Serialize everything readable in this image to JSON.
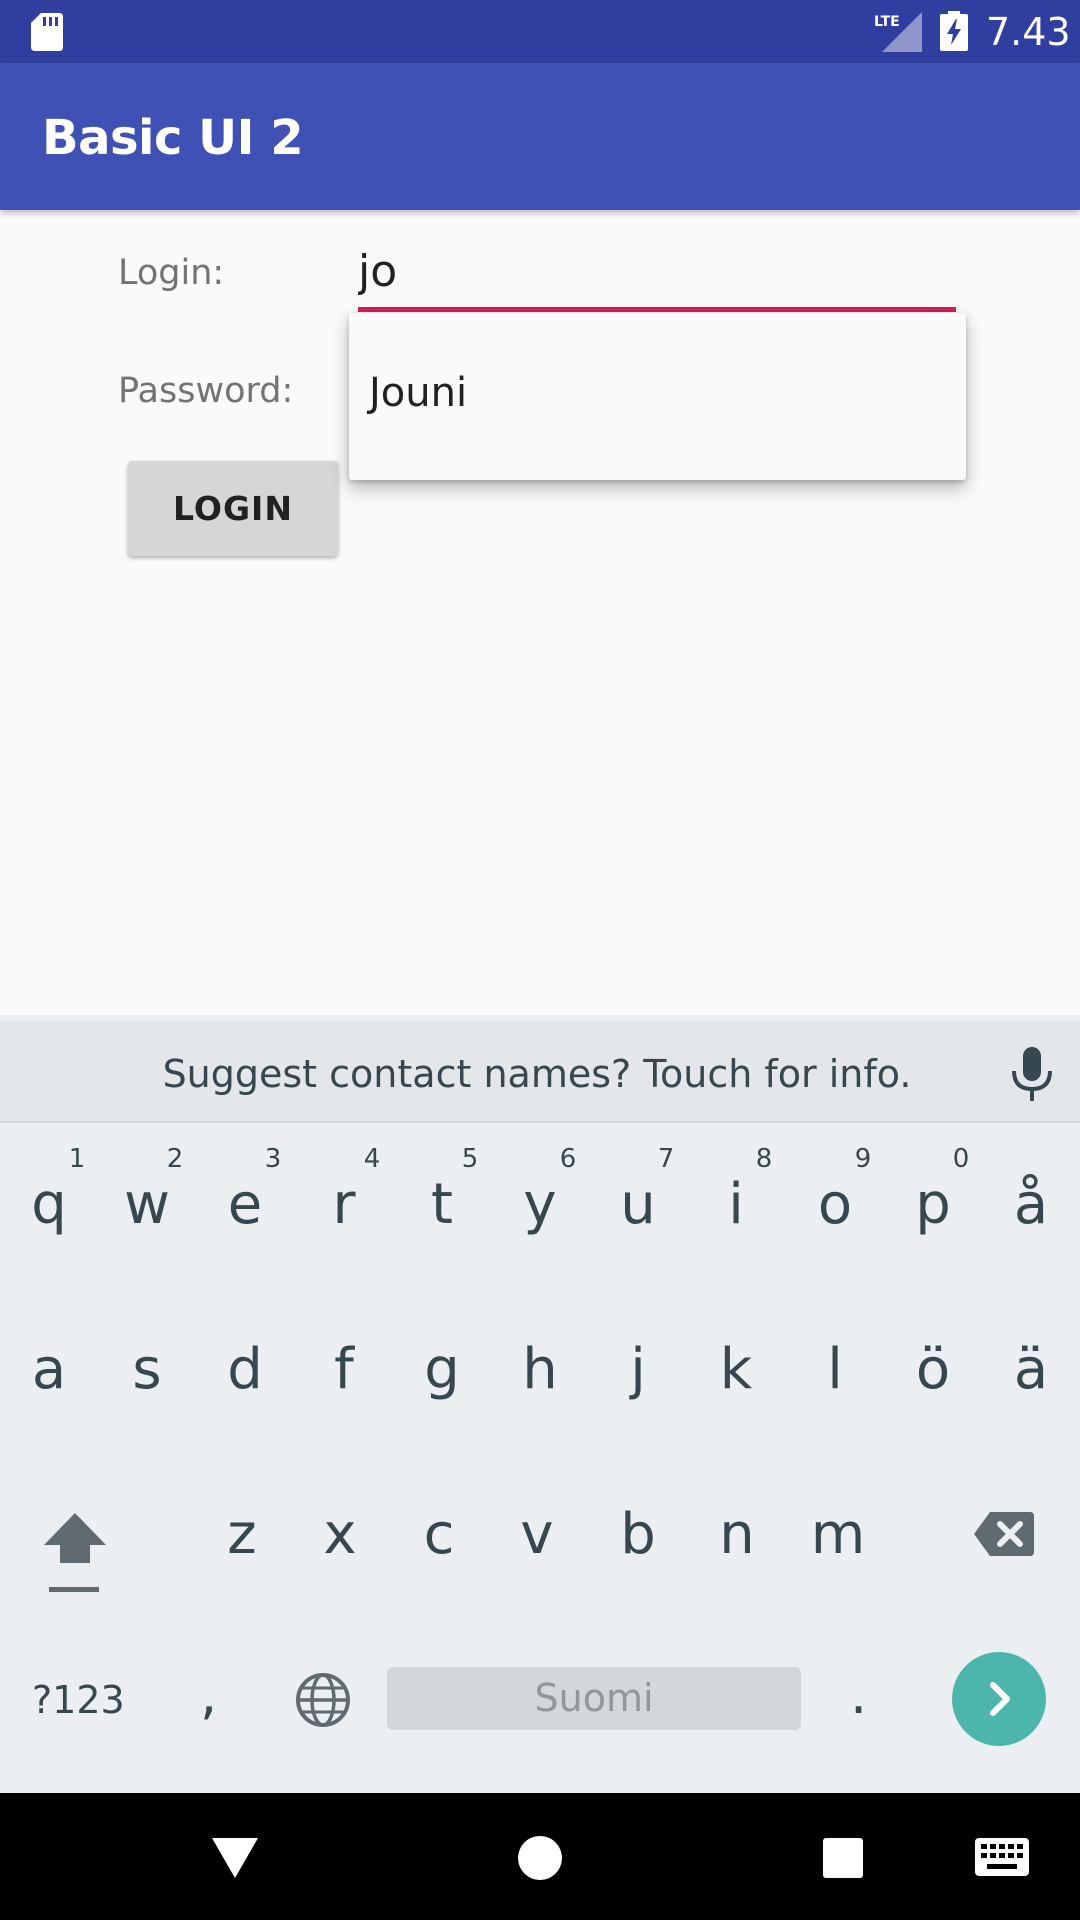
{
  "status_bar": {
    "time": "7.43",
    "network": "LTE",
    "icons": [
      "sd-card-icon",
      "lte-signal-icon",
      "battery-charging-icon"
    ]
  },
  "app_bar": {
    "title": "Basic UI 2"
  },
  "form": {
    "login_label": "Login:",
    "login_value": "jo",
    "password_label": "Password:",
    "login_button": "LOGIN"
  },
  "autocomplete": {
    "items": [
      "Jouni"
    ]
  },
  "keyboard": {
    "suggestion": "Suggest contact names? Touch for info.",
    "row1": [
      "q",
      "w",
      "e",
      "r",
      "t",
      "y",
      "u",
      "i",
      "o",
      "p",
      "å"
    ],
    "row1_hints": [
      "1",
      "2",
      "3",
      "4",
      "5",
      "6",
      "7",
      "8",
      "9",
      "0"
    ],
    "row2": [
      "a",
      "s",
      "d",
      "f",
      "g",
      "h",
      "j",
      "k",
      "l",
      "ö",
      "ä"
    ],
    "row3": [
      "z",
      "x",
      "c",
      "v",
      "b",
      "n",
      "m"
    ],
    "symbols_label": "?123",
    "comma_label": ",",
    "space_label": "Suomi",
    "period_label": ".",
    "icons": [
      "shift-icon",
      "backspace-icon",
      "globe-icon",
      "enter-icon",
      "mic-icon"
    ]
  },
  "nav_bar": {
    "icons": [
      "back-icon",
      "home-icon",
      "recents-icon",
      "keyboard-icon"
    ]
  },
  "colors": {
    "status_bar": "#303f9f",
    "app_bar": "#3f51b5",
    "accent": "#d81b60",
    "enter_key": "#4db6ac"
  }
}
